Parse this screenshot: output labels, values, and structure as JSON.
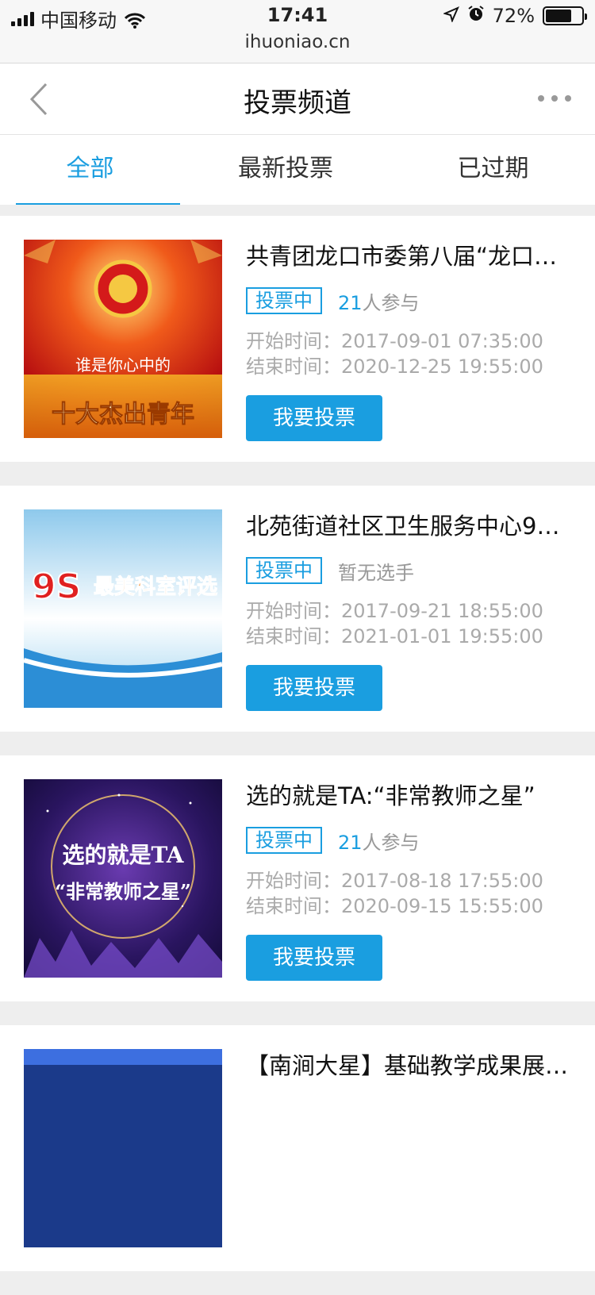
{
  "status_bar": {
    "carrier": "中国移动",
    "time": "17:41",
    "url": "ihuoniao.cn",
    "battery": "72%",
    "battery_level": 0.72
  },
  "nav": {
    "title": "投票频道"
  },
  "tabs": [
    {
      "label": "全部",
      "active": true
    },
    {
      "label": "最新投票",
      "active": false
    },
    {
      "label": "已过期",
      "active": false
    }
  ],
  "items": [
    {
      "title": "共青团龙口市委第八届“龙口…",
      "status": "投票中",
      "participants_num": "21",
      "participants_suffix": "人参与",
      "start": "开始时间：2017-09-01 07:35:00",
      "end": "结束时间：2020-12-25 19:55:00",
      "button": "我要投票",
      "thumb_text_1": "谁是你心中的",
      "thumb_text_2": "十大杰出青年"
    },
    {
      "title": "北苑街道社区卫生服务中心9…",
      "status": "投票中",
      "participants_text": "暂无选手",
      "start": "开始时间：2017-09-21 18:55:00",
      "end": "结束时间：2021-01-01 19:55:00",
      "button": "我要投票",
      "thumb_text_1": "9S",
      "thumb_text_2": "最美科室评选"
    },
    {
      "title": "选的就是TA:“非常教师之星”",
      "status": "投票中",
      "participants_num": "21",
      "participants_suffix": "人参与",
      "start": "开始时间：2017-08-18 17:55:00",
      "end": "结束时间：2020-09-15 15:55:00",
      "button": "我要投票",
      "thumb_text_1": "选的就是TA",
      "thumb_text_2": "“非常教师之星”"
    },
    {
      "title": "【南涧大星】基础教学成果展…"
    }
  ],
  "colors": {
    "accent": "#1a9ee0",
    "page_bg": "#eeeeee"
  }
}
